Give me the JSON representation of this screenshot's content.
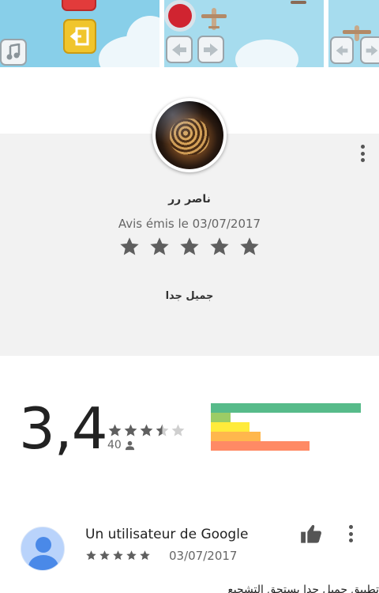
{
  "screenshots": {
    "items": [
      {
        "name": "game-menu-screenshot"
      },
      {
        "name": "plane-level-screenshot"
      },
      {
        "name": "partial-screenshot"
      }
    ]
  },
  "review_detail": {
    "avatar_icon": "reviewer-photo-leopard",
    "reviewer_name": "ناصر رر",
    "date_text": "Avis émis le 03/07/2017",
    "rating": 5,
    "review_text": "جميل جدا",
    "menu_icon": "more-vert-icon"
  },
  "rating_summary": {
    "average": "3,4",
    "stars_value": 3.5,
    "count": "40",
    "count_icon": "person-icon",
    "distribution": [
      {
        "stars": 5,
        "fraction": 1.0,
        "color": "#57bb8a"
      },
      {
        "stars": 4,
        "fraction": 0.13,
        "color": "#9ccc65"
      },
      {
        "stars": 3,
        "fraction": 0.26,
        "color": "#ffeb3b"
      },
      {
        "stars": 2,
        "fraction": 0.33,
        "color": "#ffb74d"
      },
      {
        "stars": 1,
        "fraction": 0.66,
        "color": "#ff8a65"
      }
    ]
  },
  "user_review": {
    "author": "Un utilisateur de Google",
    "rating": 5,
    "date": "03/07/2017",
    "text": "تطبيق جميل جدا يستحق التشجيع",
    "like_icon": "thumbs-up-icon",
    "menu_icon": "more-vert-icon"
  },
  "colors": {
    "star_filled": "#5f5f5f",
    "star_empty": "#cfcfcf",
    "card_bg": "#f2f2f2",
    "avatar_blue": "#4a89e8"
  }
}
